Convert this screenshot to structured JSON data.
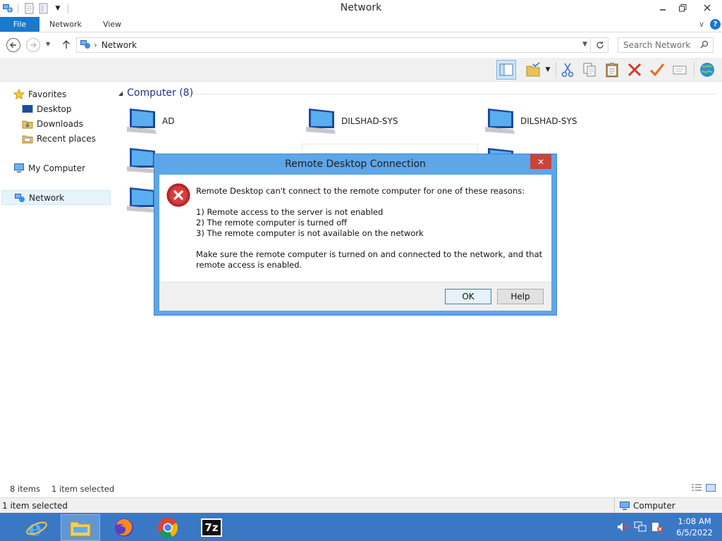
{
  "window": {
    "title": "Network",
    "controls": {
      "minimize": "–",
      "maximize": "❐",
      "close": "✕"
    }
  },
  "ribbon": {
    "tabs": [
      "File",
      "Network",
      "View"
    ],
    "expand": "∨",
    "help": "?"
  },
  "address": {
    "path": "Network",
    "separator": "›",
    "search_placeholder": "Search Network"
  },
  "nav_pane": {
    "favorites": "Favorites",
    "favorites_items": [
      "Desktop",
      "Downloads",
      "Recent places"
    ],
    "my_computer": "My Computer",
    "network": "Network"
  },
  "content": {
    "group_title": "Computer (8)",
    "computers": [
      "AD",
      "DILSHAD-SYS",
      "DILSHAD-SYS"
    ]
  },
  "dialog": {
    "title": "Remote Desktop Connection",
    "close": "✕",
    "intro": "Remote Desktop can't connect to the remote computer for one of these reasons:",
    "reasons": [
      "1) Remote access to the server is not enabled",
      "2) The remote computer is turned off",
      "3) The remote computer is not available on the network"
    ],
    "advice": "Make sure the remote computer is turned on and connected to the network, and that remote access is enabled.",
    "buttons": {
      "ok": "OK",
      "help": "Help"
    }
  },
  "status": {
    "items_count": "8 items",
    "selected_count": "1 item selected"
  },
  "info_bar": {
    "left": "1 item selected",
    "right": "Computer"
  },
  "taskbar": {
    "apps": [
      "internet-explorer",
      "file-explorer",
      "firefox",
      "chrome",
      "7-zip"
    ],
    "seven_zip_label": "7z",
    "time": "1:08 AM",
    "date": "6/5/2022"
  },
  "colors": {
    "accent": "#1979ca",
    "taskbar": "#3b78c4",
    "dialog_frame": "#5da6e8",
    "group_title": "#1e3287"
  }
}
